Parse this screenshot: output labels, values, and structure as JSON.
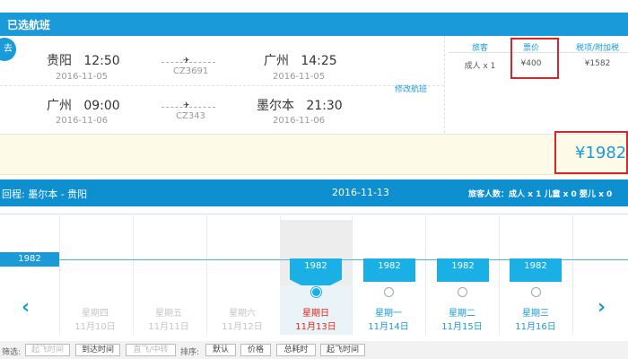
{
  "header": {
    "title": "已选航班"
  },
  "outbound": {
    "badge": "去",
    "modify_label": "修改航班",
    "legs": [
      {
        "from_city": "贵阳",
        "from_time": "12:50",
        "from_date": "2016-11-05",
        "flight_no": "CZ3691",
        "to_city": "广州",
        "to_time": "14:25",
        "to_date": "2016-11-05"
      },
      {
        "from_city": "广州",
        "from_time": "09:00",
        "from_date": "2016-11-06",
        "flight_no": "CZ343",
        "to_city": "墨尔本",
        "to_time": "21:30",
        "to_date": "2016-11-06"
      }
    ]
  },
  "price_table": {
    "headers": [
      "旅客",
      "票价",
      "税项/附加税"
    ],
    "values": [
      "成人 x 1",
      "¥400",
      "¥1582"
    ]
  },
  "total": "¥1982",
  "return_bar": {
    "route": "回程:  墨尔本 - 贵阳",
    "date": "2016-11-13",
    "passengers": "旅客人数：成人 x 1   儿童 x 0   婴儿 x 0"
  },
  "calendar": {
    "baseline_price": "1982",
    "days": [
      {
        "weekday": "星期四",
        "date": "11月10日",
        "price": "",
        "state": "disabled"
      },
      {
        "weekday": "星期五",
        "date": "11月11日",
        "price": "",
        "state": "disabled"
      },
      {
        "weekday": "星期六",
        "date": "11月12日",
        "price": "",
        "state": "disabled"
      },
      {
        "weekday": "星期日",
        "date": "11月13日",
        "price": "1982",
        "state": "selected"
      },
      {
        "weekday": "星期一",
        "date": "11月14日",
        "price": "1982",
        "state": "available"
      },
      {
        "weekday": "星期二",
        "date": "11月15日",
        "price": "1982",
        "state": "available"
      },
      {
        "weekday": "星期三",
        "date": "11月16日",
        "price": "1982",
        "state": "available"
      }
    ],
    "prev_icon": "chevron-left-icon",
    "next_icon": "chevron-right-icon"
  },
  "filter": {
    "filter_label": "筛选:",
    "filter_buttons": [
      "起飞时间",
      "到达时间",
      "直飞/中转"
    ],
    "sort_label": "排序:",
    "sort_buttons": [
      "默认",
      "价格",
      "总耗时",
      "起飞时间"
    ]
  },
  "colors": {
    "accent": "#1a9ad8",
    "highlight_box": "#d9262c",
    "selected_day": "#e0261c"
  }
}
